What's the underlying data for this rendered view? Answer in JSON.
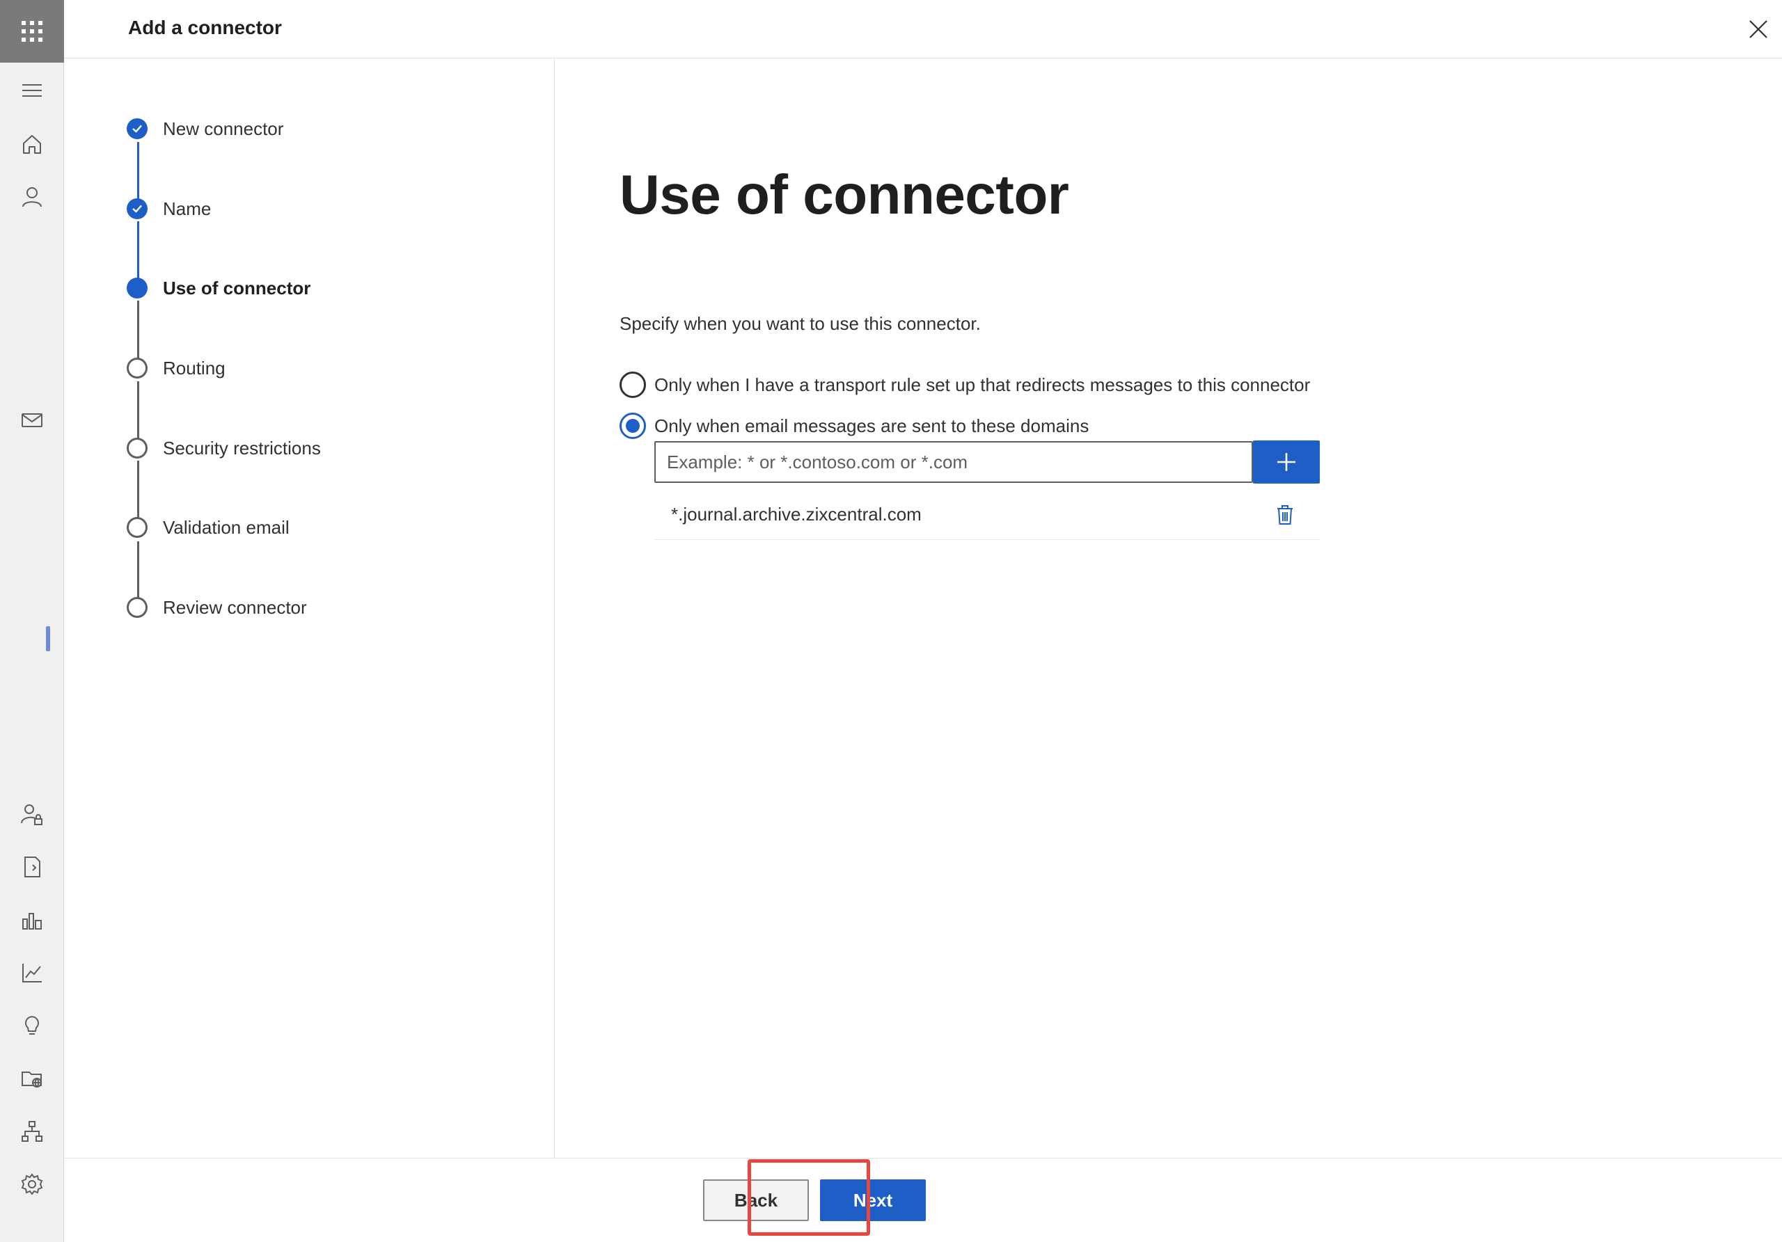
{
  "header": {
    "title": "Add a connector"
  },
  "steps": [
    {
      "label": "New connector",
      "state": "done"
    },
    {
      "label": "Name",
      "state": "done"
    },
    {
      "label": "Use of connector",
      "state": "current"
    },
    {
      "label": "Routing",
      "state": "todo"
    },
    {
      "label": "Security restrictions",
      "state": "todo"
    },
    {
      "label": "Validation email",
      "state": "todo"
    },
    {
      "label": "Review connector",
      "state": "todo"
    }
  ],
  "main": {
    "title": "Use of connector",
    "description": "Specify when you want to use this connector.",
    "options": [
      {
        "label": "Only when I have a transport rule set up that redirects messages to this connector",
        "selected": false
      },
      {
        "label": "Only when email messages are sent to these domains",
        "selected": true
      }
    ],
    "domain_input": {
      "placeholder": "Example: * or *.contoso.com or *.com",
      "value": ""
    },
    "domains": [
      "*.journal.archive.zixcentral.com"
    ]
  },
  "footer": {
    "back_label": "Back",
    "next_label": "Next"
  },
  "colors": {
    "accent": "#1e5fc7",
    "highlight": "#e8473f"
  },
  "rail_icons": [
    "app-launcher-icon",
    "menu-icon",
    "home-icon",
    "user-icon",
    "mail-icon",
    "user-lock-icon",
    "document-icon",
    "reports-icon",
    "trend-icon",
    "lightbulb-icon",
    "folder-globe-icon",
    "org-chart-icon",
    "settings-icon"
  ]
}
